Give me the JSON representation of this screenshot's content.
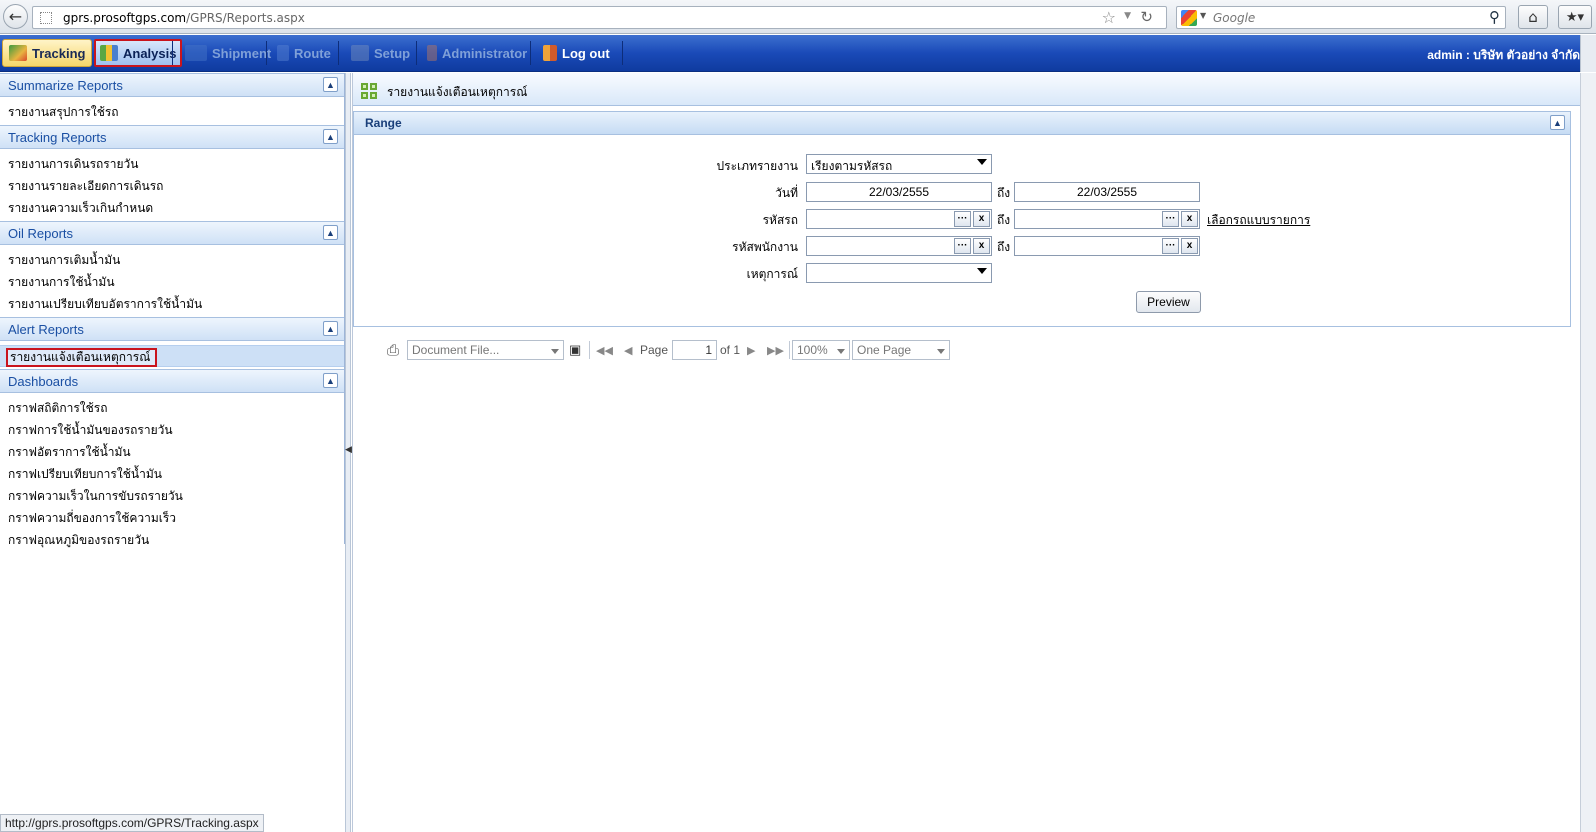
{
  "browser": {
    "url_host": "gprs.prosoftgps.com",
    "url_path": "/GPRS/Reports.aspx",
    "search_placeholder": "Google",
    "status_url": "http://gprs.prosoftgps.com/GPRS/Tracking.aspx"
  },
  "nav": {
    "tracking": "Tracking",
    "analysis": "Analysis",
    "shipment": "Shipment",
    "route": "Route",
    "setup": "Setup",
    "administrator": "Administrator",
    "logout": "Log out",
    "user": "admin : บริษัท ตัวอย่าง จำกัด"
  },
  "sidebar": {
    "sections": [
      {
        "title": "Summarize Reports",
        "items": [
          "รายงานสรุปการใช้รถ"
        ]
      },
      {
        "title": "Tracking Reports",
        "items": [
          "รายงานการเดินรถรายวัน",
          "รายงานรายละเอียดการเดินรถ",
          "รายงานความเร็วเกินกำหนด"
        ]
      },
      {
        "title": "Oil Reports",
        "items": [
          "รายงานการเติมน้ำมัน",
          "รายงานการใช้น้ำมัน",
          "รายงานเปรียบเทียบอัตราการใช้น้ำมัน"
        ]
      },
      {
        "title": "Alert Reports",
        "items": [
          "รายงานแจ้งเตือนเหตุการณ์"
        ]
      },
      {
        "title": "Dashboards",
        "items": [
          "กราฟสถิติการใช้รถ",
          "กราฟการใช้น้ำมันของรถรายวัน",
          "กราฟอัตราการใช้น้ำมัน",
          "กราฟเปรียบเทียบการใช้น้ำมัน",
          "กราฟความเร็วในการขับรถรายวัน",
          "กราฟความถี่ของการใช้ความเร็ว",
          "กราฟอุณหภูมิของรถรายวัน"
        ]
      }
    ],
    "selected": "รายงานแจ้งเตือนเหตุการณ์"
  },
  "report": {
    "title": "รายงานแจ้งเตือนเหตุการณ์",
    "range_title": "Range",
    "labels": {
      "report_type": "ประเภทรายงาน",
      "date": "วันที่",
      "vehicle_code": "รหัสรถ",
      "employee_code": "รหัสพนักงาน",
      "event": "เหตุการณ์",
      "to": "ถึง"
    },
    "values": {
      "report_type": "เรียงตามรหัสรถ",
      "date_from": "22/03/2555",
      "date_to": "22/03/2555",
      "vehicle_from": "",
      "vehicle_to": "",
      "employee_from": "",
      "employee_to": "",
      "event": ""
    },
    "select_vehicle_link": "เลือกรถแบบรายการ",
    "preview_button": "Preview",
    "browse_label": "···",
    "clear_label": "x"
  },
  "viewer": {
    "export_format": "Document File...",
    "page_label": "Page",
    "page_number": "1",
    "page_of": "of 1",
    "zoom": "100%",
    "view_mode": "One Page"
  }
}
